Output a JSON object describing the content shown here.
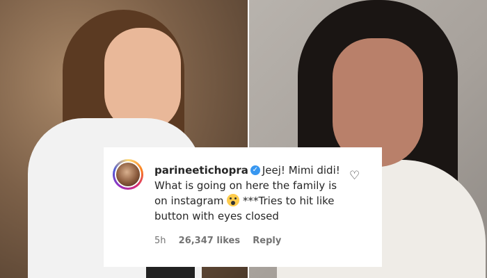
{
  "comment": {
    "username": "parineetichopra",
    "text_before_emoji": "Jeej! Mimi didi! What is going on here the family is on instagram ",
    "text_after_emoji": " ***Tries to hit like button with eyes closed",
    "time": "5h",
    "likes": "26,347 likes",
    "reply_label": "Reply",
    "verified_glyph": "✓",
    "heart_glyph": "♡"
  },
  "icons": [
    "verified-badge-icon",
    "heart-icon",
    "shocked-face-emoji"
  ],
  "colors": {
    "verified": "#3897f0",
    "text": "#262626",
    "meta": "#737373"
  }
}
